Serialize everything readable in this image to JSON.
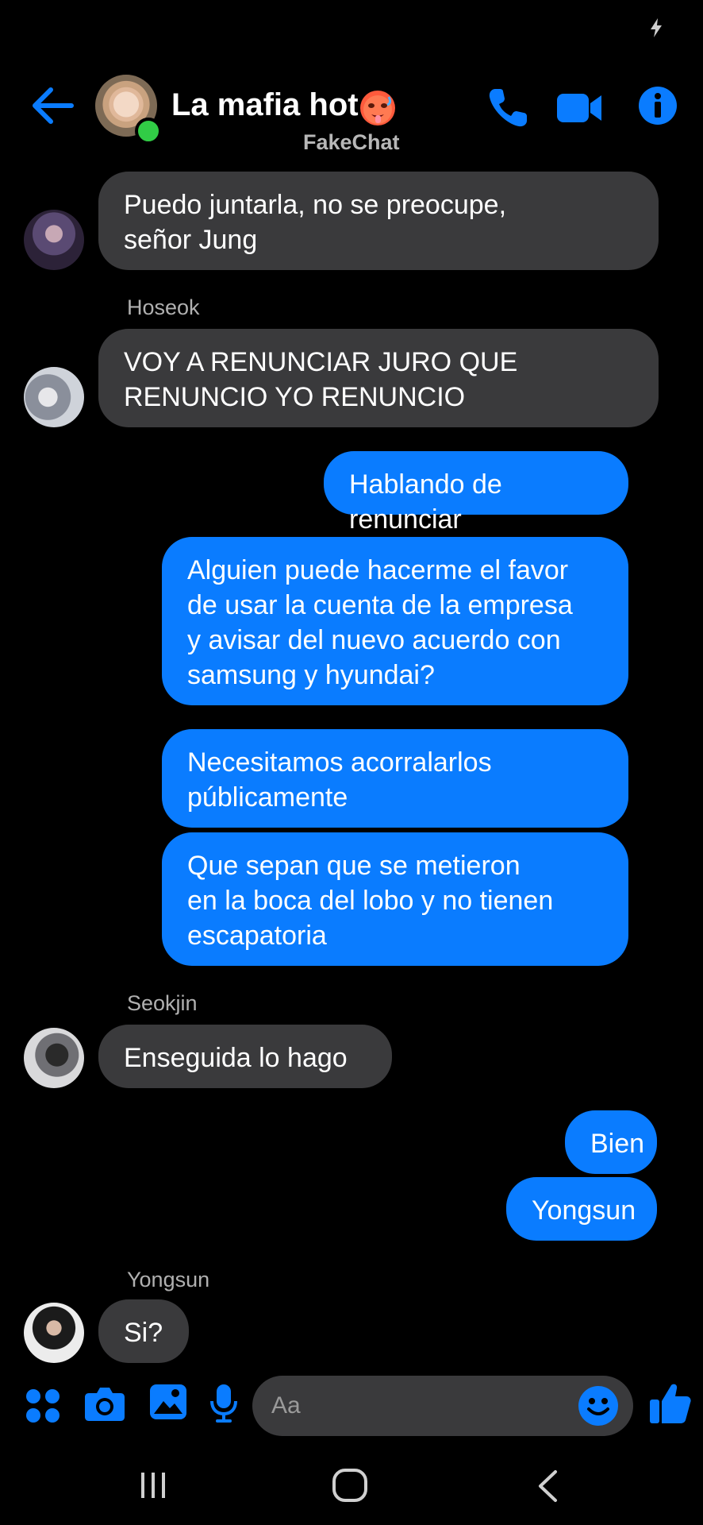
{
  "header": {
    "title": "La mafia hot",
    "watermark": "FakeChat"
  },
  "messages": [
    {
      "type": "incoming",
      "text": "Puedo juntarla, no se preocupe,\nseñor Jung"
    },
    {
      "type": "incoming",
      "sender": "Hoseok",
      "text": "VOY A RENUNCIAR JURO QUE\nRENUNCIO YO RENUNCIO"
    },
    {
      "type": "outgoing",
      "text": "Hablando de renunciar"
    },
    {
      "type": "outgoing",
      "text": "Alguien puede hacerme el favor\nde usar la cuenta de la empresa\ny avisar del nuevo acuerdo con\nsamsung y hyundai?"
    },
    {
      "type": "outgoing",
      "text": "Necesitamos acorralarlos\npúblicamente"
    },
    {
      "type": "outgoing",
      "text": "Que sepan que se metieron\nen la boca del lobo y no tienen\nescapatoria"
    },
    {
      "type": "incoming",
      "sender": "Seokjin",
      "text": "Enseguida lo hago"
    },
    {
      "type": "outgoing",
      "text": "Bien"
    },
    {
      "type": "outgoing",
      "text": "Yongsun"
    },
    {
      "type": "incoming",
      "sender": "Yongsun",
      "text": "Si?"
    }
  ],
  "composer": {
    "placeholder": "Aa"
  },
  "colors": {
    "accent": "#0a7cff",
    "incoming_bubble": "#3a3a3c",
    "background": "#000000",
    "online": "#31cc46"
  },
  "icons": [
    "back-arrow-icon",
    "phone-icon",
    "video-camera-icon",
    "info-icon",
    "apps-grid-icon",
    "camera-icon",
    "gallery-icon",
    "microphone-icon",
    "emoji-icon",
    "thumbs-up-icon"
  ]
}
